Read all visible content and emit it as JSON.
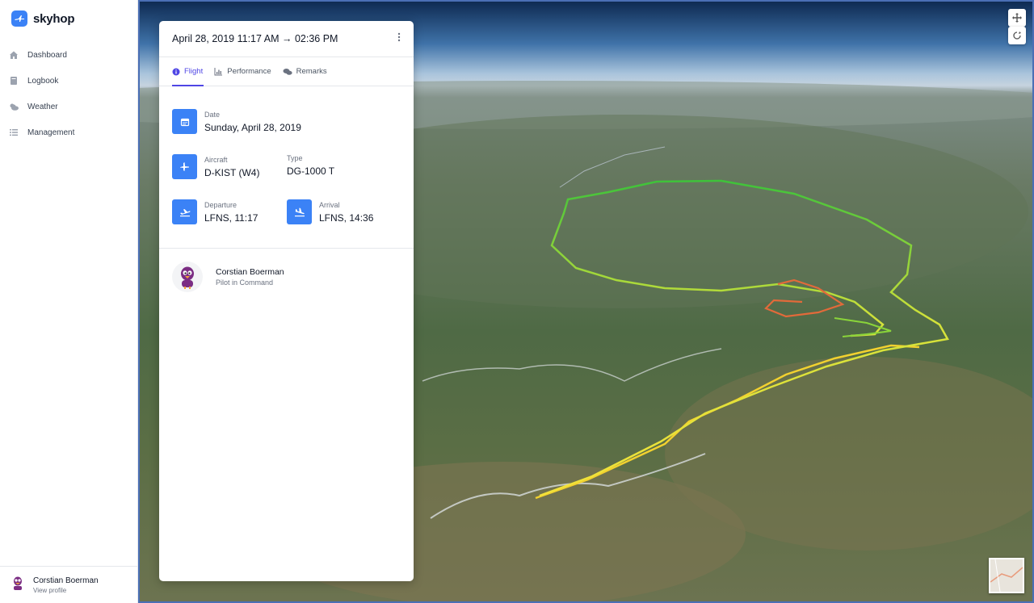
{
  "app": {
    "name": "skyhop"
  },
  "sidebar": {
    "items": [
      {
        "label": "Dashboard",
        "icon": "home-icon"
      },
      {
        "label": "Logbook",
        "icon": "book-icon"
      },
      {
        "label": "Weather",
        "icon": "cloud-icon"
      },
      {
        "label": "Management",
        "icon": "list-icon"
      }
    ],
    "user": {
      "name": "Corstian Boerman",
      "link": "View profile"
    }
  },
  "card": {
    "title": "April 28, 2019 11:17 AM → 02:36 PM",
    "tabs": [
      {
        "label": "Flight",
        "icon": "info-icon",
        "active": true
      },
      {
        "label": "Performance",
        "icon": "chart-icon",
        "active": false
      },
      {
        "label": "Remarks",
        "icon": "comments-icon",
        "active": false
      }
    ],
    "date": {
      "label": "Date",
      "value": "Sunday, April 28, 2019"
    },
    "aircraft": {
      "label": "Aircraft",
      "value": "D-KIST (W4)"
    },
    "type": {
      "label": "Type",
      "value": "DG-1000 T"
    },
    "departure": {
      "label": "Departure",
      "value": "LFNS, 11:17"
    },
    "arrival": {
      "label": "Arrival",
      "value": "LFNS, 14:36"
    },
    "pilot": {
      "name": "Corstian Boerman",
      "role": "Pilot in Command"
    }
  },
  "colors": {
    "accent": "#3b82f6",
    "tab_active": "#4f46e5"
  }
}
